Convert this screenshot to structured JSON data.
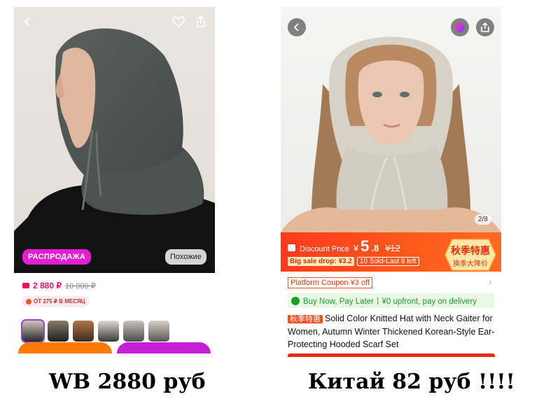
{
  "left": {
    "badges": {
      "sale": "РАСПРОДАЖА",
      "similar": "Похожие"
    },
    "price": {
      "current": "2 880 ₽",
      "old": "10 000 ₽"
    },
    "installment": "ОТ 275 ₽ В МЕСЯЦ",
    "thumbnails": 6,
    "colors": {
      "sale": "#e21fd3",
      "price": "#e0145f",
      "btn_left": "#ff7a00",
      "btn_right": "#c41fd4"
    }
  },
  "right": {
    "counter": "2/8",
    "discount": {
      "label": "Discount Price",
      "currency": "¥",
      "price_int": "5",
      "price_dec": ".8",
      "old_price": "¥12",
      "sale_drop": "Big sale drop: ¥3.2",
      "sold": "10 Sold-Last 9 left"
    },
    "autumn_badge": {
      "line1": "秋季特惠",
      "line2": "换季大降价"
    },
    "coupon": "Platform Coupon ¥3 off",
    "bnpl": "Buy Now, Pay Later丨¥0 upfront, pay on delivery",
    "title_tag": "秋季特惠",
    "title": "Solid Color Knitted Hat with Neck Gaiter for Women, Autumn Winter Thickened Korean-Style Ear-Protecting Hooded Scarf Set",
    "colors": {
      "banner": "#ff4a1d",
      "bnpl_text": "#1d9d24",
      "coupon": "#e8380f"
    }
  },
  "captions": {
    "left": "WB 2880 руб",
    "right": "Китай 82 руб !!!!"
  }
}
